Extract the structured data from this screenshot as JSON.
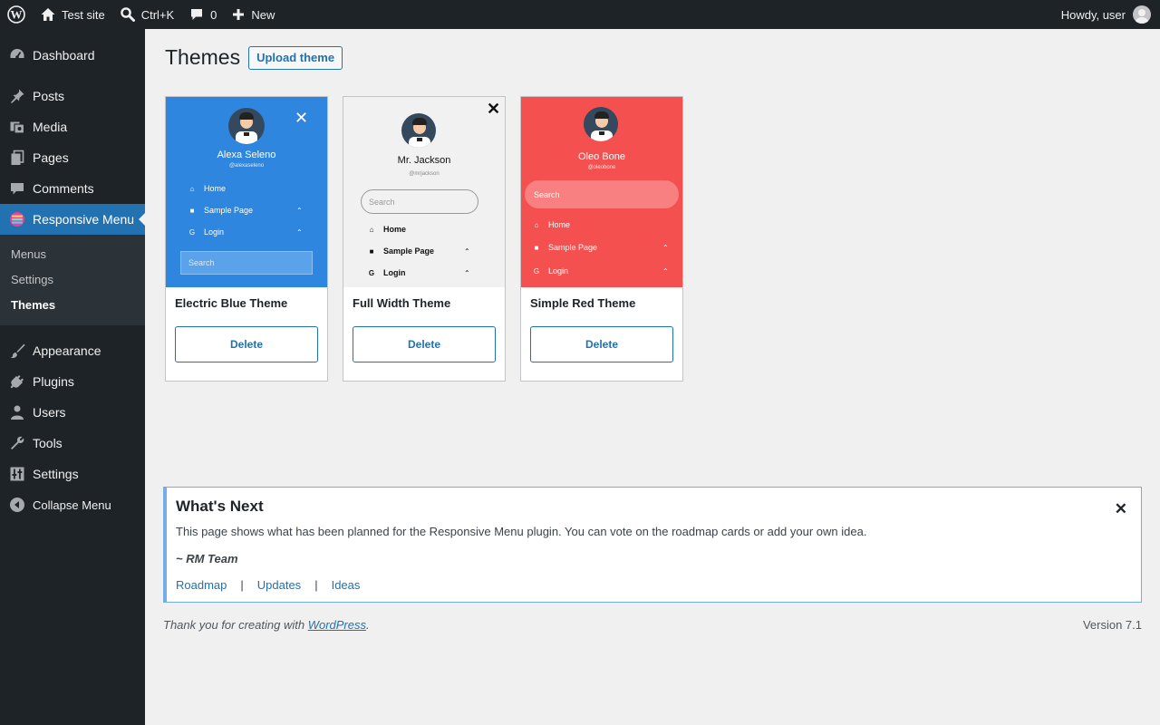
{
  "adminbar": {
    "site_name": "Test site",
    "search_shortcut": "Ctrl+K",
    "comments_count": "0",
    "new_label": "New",
    "howdy": "Howdy, user"
  },
  "sidebar": {
    "items": [
      {
        "label": "Dashboard",
        "icon": "dashboard-icon"
      },
      {
        "label": "Posts",
        "icon": "pin-icon"
      },
      {
        "label": "Media",
        "icon": "media-icon"
      },
      {
        "label": "Pages",
        "icon": "pages-icon"
      },
      {
        "label": "Comments",
        "icon": "comment-icon"
      },
      {
        "label": "Responsive Menu",
        "icon": "responsive-menu-icon"
      },
      {
        "label": "Appearance",
        "icon": "brush-icon"
      },
      {
        "label": "Plugins",
        "icon": "plug-icon"
      },
      {
        "label": "Users",
        "icon": "user-icon"
      },
      {
        "label": "Tools",
        "icon": "wrench-icon"
      },
      {
        "label": "Settings",
        "icon": "settings-sliders-icon"
      }
    ],
    "submenu": [
      "Menus",
      "Settings",
      "Themes"
    ],
    "collapse_label": "Collapse Menu"
  },
  "page": {
    "title": "Themes",
    "upload_button": "Upload theme"
  },
  "themes": [
    {
      "name": "Electric Blue Theme",
      "delete_label": "Delete",
      "preview": {
        "bg": "#2e86de",
        "person": "Alexa Seleno",
        "handle": "@alexaseleno",
        "menu": [
          "Home",
          "Sample Page",
          "Login"
        ],
        "search": "Search"
      }
    },
    {
      "name": "Full Width Theme",
      "delete_label": "Delete",
      "preview": {
        "bg": "#f1f1f1",
        "person": "Mr. Jackson",
        "handle": "@mrjackson",
        "menu": [
          "Home",
          "Sample Page",
          "Login"
        ],
        "search": "Search"
      }
    },
    {
      "name": "Simple Red Theme",
      "delete_label": "Delete",
      "preview": {
        "bg": "#f55050",
        "person": "Oleo Bone",
        "handle": "@oleobone",
        "menu": [
          "Home",
          "Sample Page",
          "Login"
        ],
        "search": "Search"
      }
    }
  ],
  "notice": {
    "title": "What's Next",
    "text": "This page shows what has been planned for the Responsive Menu plugin. You can vote on the roadmap cards or add your own idea.",
    "signature": "~ RM Team",
    "links": [
      "Roadmap",
      "Updates",
      "Ideas"
    ],
    "separator": "|",
    "close": "✕"
  },
  "footer": {
    "thanks": "Thank you for creating with ",
    "wp_link": "WordPress",
    "period": ".",
    "version": "Version 7.1"
  },
  "colors": {
    "accent": "#2271b1",
    "adminbar_bg": "#1d2327",
    "notice_border": "#72aee6"
  }
}
